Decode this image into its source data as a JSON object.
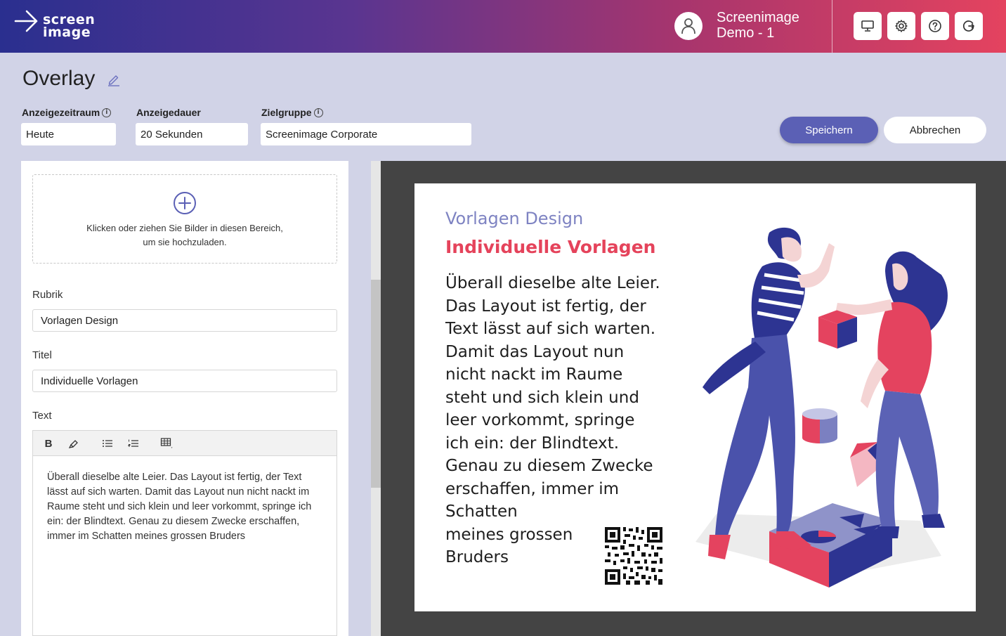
{
  "header": {
    "logo_line1": "screen",
    "logo_line2": "image",
    "user_name_line1": "Screenimage",
    "user_name_line2": "Demo - 1",
    "icons": [
      "monitor-icon",
      "gear-icon",
      "help-icon",
      "logout-icon"
    ]
  },
  "toolbar": {
    "title": "Overlay",
    "fields": {
      "period_label": "Anzeigezeitraum",
      "period_value": "Heute",
      "duration_label": "Anzeigedauer",
      "duration_value": "20 Sekunden",
      "target_label": "Zielgruppe",
      "target_value": "Screenimage Corporate"
    },
    "save_label": "Speichern",
    "cancel_label": "Abbrechen"
  },
  "form": {
    "upload_text_line1": "Klicken oder ziehen Sie Bilder in diesen Bereich,",
    "upload_text_line2": "um sie hochzuladen.",
    "rubrik_label": "Rubrik",
    "rubrik_value": "Vorlagen Design",
    "titel_label": "Titel",
    "titel_value": "Individuelle Vorlagen",
    "text_label": "Text",
    "text_value": "Überall dieselbe alte Leier. Das Layout ist fertig, der Text lässt auf sich warten. Damit das Layout nun nicht nackt im Raume steht und sich klein und leer vorkommt, springe ich ein: der Blindtext. Genau zu diesem Zwecke erschaffen, immer im Schatten meines grossen Bruders"
  },
  "preview": {
    "rubrik": "Vorlagen Design",
    "title": "Individuelle Vorlagen",
    "lines": [
      "Überall dieselbe alte Leier.",
      "Das Layout ist fertig, der",
      "Text lässt auf sich warten.",
      "Damit das Layout nun",
      "nicht nackt im Raume",
      "steht und sich klein und",
      "leer vorkommt, springe",
      "ich ein: der Blindtext.",
      "Genau zu diesem Zwecke",
      "erschaffen, immer im",
      "Schatten",
      "meines grossen",
      "Bruders"
    ]
  },
  "colors": {
    "accent": "#5b60b5",
    "brand_red": "#e5435b",
    "toolbar_bg": "#d1d3e7",
    "preview_bg": "#444444"
  }
}
